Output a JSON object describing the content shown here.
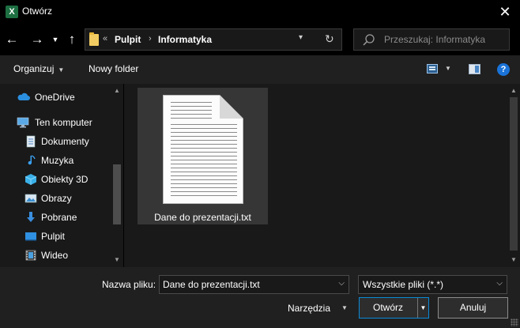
{
  "window": {
    "app_icon_glyph": "X",
    "title": "Otwórz",
    "close_glyph": "✕"
  },
  "nav": {
    "back_glyph": "←",
    "forward_glyph": "→",
    "recent_glyph": "▼",
    "up_glyph": "↑",
    "address": {
      "overflow": "«",
      "crumbs": [
        "Pulpit",
        "Informatyka"
      ],
      "separator": "›",
      "dropdown_glyph": "▾",
      "refresh_glyph": "↻"
    },
    "search_placeholder": "Przeszukaj: Informatyka"
  },
  "toolbar": {
    "organize_label": "Organizuj",
    "new_folder_label": "Nowy folder",
    "caret": "▼",
    "help_glyph": "?"
  },
  "sidebar": {
    "items": [
      {
        "label": "OneDrive",
        "icon": "onedrive-icon"
      },
      {
        "label": "Ten komputer",
        "icon": "this-pc-icon"
      },
      {
        "label": "Dokumenty",
        "icon": "documents-icon"
      },
      {
        "label": "Muzyka",
        "icon": "music-icon"
      },
      {
        "label": "Obiekty 3D",
        "icon": "objects-3d-icon"
      },
      {
        "label": "Obrazy",
        "icon": "pictures-icon"
      },
      {
        "label": "Pobrane",
        "icon": "downloads-icon"
      },
      {
        "label": "Pulpit",
        "icon": "desktop-icon"
      },
      {
        "label": "Wideo",
        "icon": "videos-icon"
      }
    ]
  },
  "files": [
    {
      "name": "Dane do prezentacji.txt",
      "icon": "text-file-icon"
    }
  ],
  "bottom": {
    "filename_label": "Nazwa pliku:",
    "filename_value": "Dane do prezentacji.txt",
    "filetype_value": "Wszystkie pliki (*.*)",
    "tools_label": "Narzędzia",
    "open_label": "Otwórz",
    "cancel_label": "Anuluj"
  },
  "colors": {
    "accent": "#0b8ad8",
    "background": "#191919",
    "panel": "#202020"
  }
}
